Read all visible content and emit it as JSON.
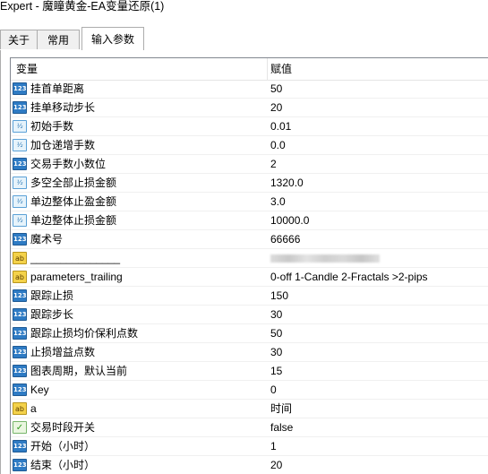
{
  "window": {
    "title": "Expert - 魔瞳黄金-EA变量还原(1)"
  },
  "tabs": [
    {
      "label": "关于"
    },
    {
      "label": "常用"
    },
    {
      "label": "输入参数"
    }
  ],
  "grid": {
    "col_variable": "变量",
    "col_value": "赋值",
    "rows": [
      {
        "name": "挂首单距离",
        "value": "50",
        "type": "int"
      },
      {
        "name": "挂单移动步长",
        "value": "20",
        "type": "int"
      },
      {
        "name": "初始手数",
        "value": "0.01",
        "type": "double"
      },
      {
        "name": "加仓递增手数",
        "value": "0.0",
        "type": "double"
      },
      {
        "name": "交易手数小数位",
        "value": "2",
        "type": "int"
      },
      {
        "name": "多空全部止损金额",
        "value": "1320.0",
        "type": "double"
      },
      {
        "name": "单边整体止盈金额",
        "value": "3.0",
        "type": "double"
      },
      {
        "name": "单边整体止损金额",
        "value": "10000.0",
        "type": "double"
      },
      {
        "name": "魔术号",
        "value": "66666",
        "type": "int"
      },
      {
        "name": "_______________",
        "value": "",
        "type": "string",
        "value_obscured": true
      },
      {
        "name": "parameters_trailing",
        "value": "0-off  1-Candle  2-Fractals  >2-pips",
        "type": "string"
      },
      {
        "name": "跟踪止损",
        "value": "150",
        "type": "int"
      },
      {
        "name": "跟踪步长",
        "value": "30",
        "type": "int"
      },
      {
        "name": "跟踪止损均价保利点数",
        "value": "50",
        "type": "int"
      },
      {
        "name": "止损增益点数",
        "value": "30",
        "type": "int"
      },
      {
        "name": "图表周期，默认当前",
        "value": "15",
        "type": "int"
      },
      {
        "name": "Key",
        "value": "0",
        "type": "int"
      },
      {
        "name": "a",
        "value": "时间",
        "type": "string"
      },
      {
        "name": "交易时段开关",
        "value": "false",
        "type": "bool"
      },
      {
        "name": "开始（小时）",
        "value": "1",
        "type": "int"
      },
      {
        "name": "结束（小时）",
        "value": "20",
        "type": "int"
      }
    ]
  },
  "icons": {
    "int": {
      "name": "integer-type-icon",
      "glyph": "123"
    },
    "double": {
      "name": "double-type-icon",
      "glyph": "½"
    },
    "string": {
      "name": "string-type-icon",
      "glyph": "ab"
    },
    "bool": {
      "name": "boolean-type-icon",
      "glyph": "✓"
    }
  }
}
